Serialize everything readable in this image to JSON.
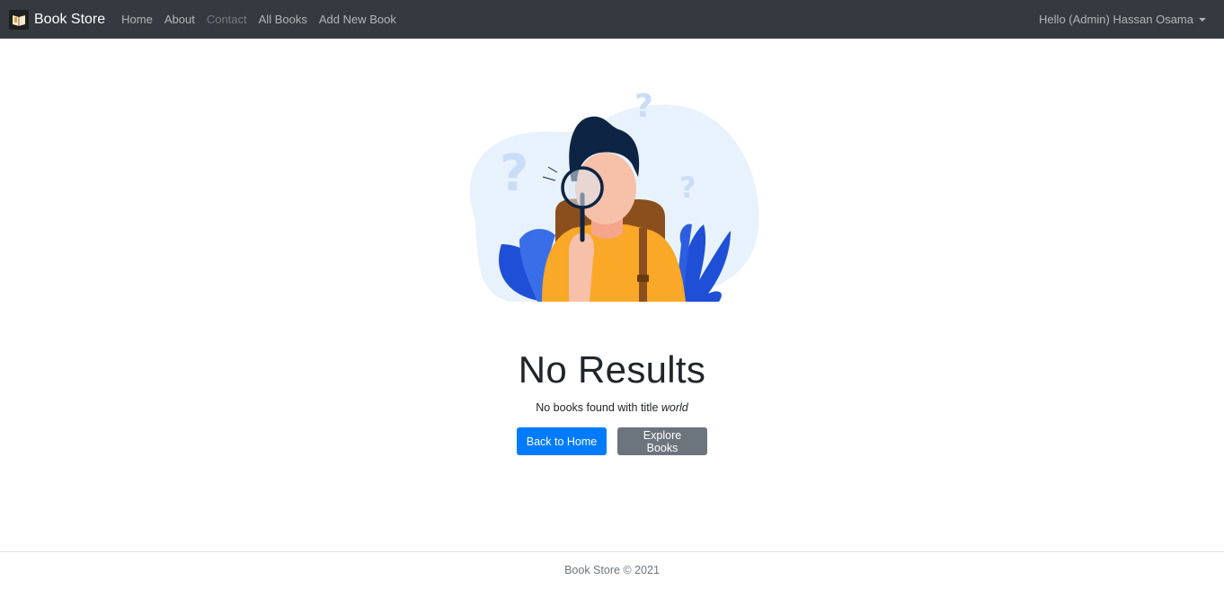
{
  "navbar": {
    "brand": "Book Store",
    "links": [
      {
        "label": "Home"
      },
      {
        "label": "About"
      },
      {
        "label": "Contact"
      },
      {
        "label": "All Books"
      },
      {
        "label": "Add New Book"
      }
    ],
    "user_label": "Hello (Admin) Hassan Osama"
  },
  "main": {
    "illustration_icon": "search-person-illustration",
    "title": "No Results",
    "subtitle_prefix": "No books found with title ",
    "subtitle_query": "world",
    "back_button": "Back to Home",
    "explore_button": "Explore Books"
  },
  "footer": {
    "text": "Book Store © 2021"
  },
  "colors": {
    "navbar_bg": "#343a40",
    "primary": "#007bff",
    "secondary": "#6c757d",
    "illustration_bg": "#e8f2fc",
    "shirt": "#f9a828",
    "leaf": "#1e4fd6",
    "hair": "#0e2444"
  }
}
